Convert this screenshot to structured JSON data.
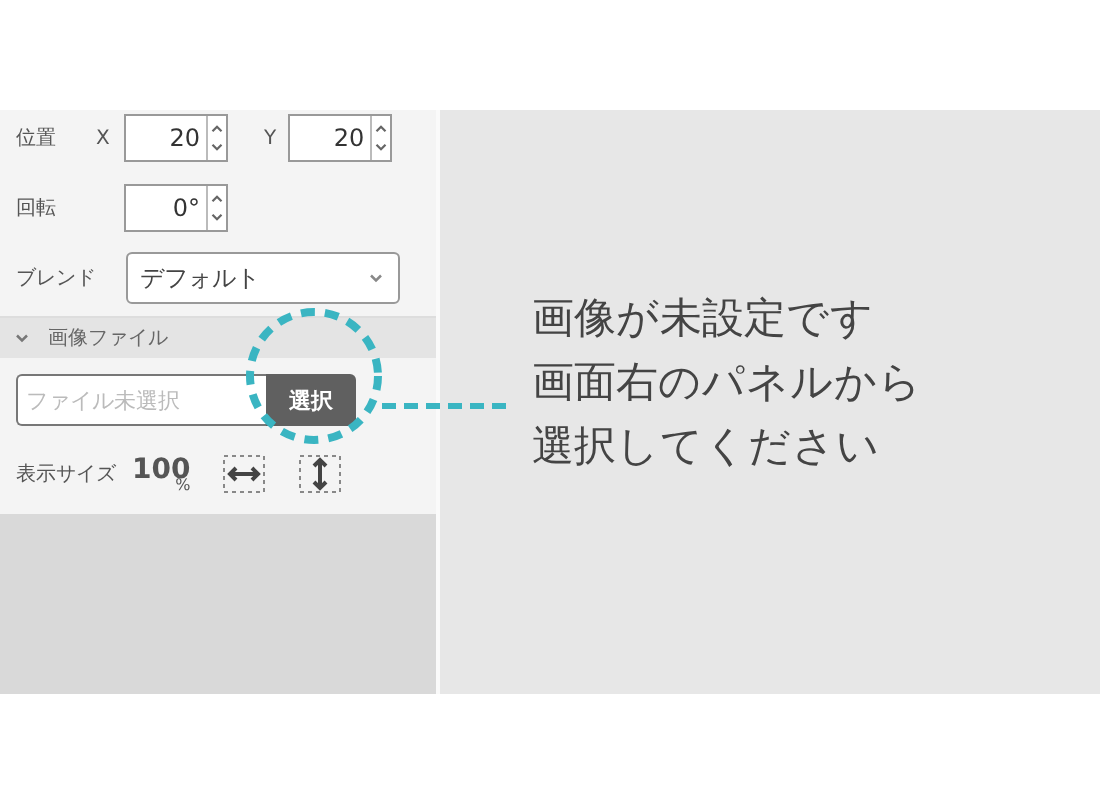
{
  "position": {
    "label": "位置",
    "x_label": "X",
    "x_value": "20",
    "y_label": "Y",
    "y_value": "20"
  },
  "rotation": {
    "label": "回転",
    "value": "0°"
  },
  "blend": {
    "label": "ブレンド",
    "value": "デフォルト"
  },
  "image_section": {
    "title": "画像ファイル",
    "expanded": true,
    "file_placeholder": "ファイル未選択",
    "select_button": "選択",
    "size_label": "表示サイズ",
    "size_value": "100",
    "size_unit": "%"
  },
  "message": [
    "画像が未設定です",
    "画面右のパネルから",
    "選択してください"
  ]
}
